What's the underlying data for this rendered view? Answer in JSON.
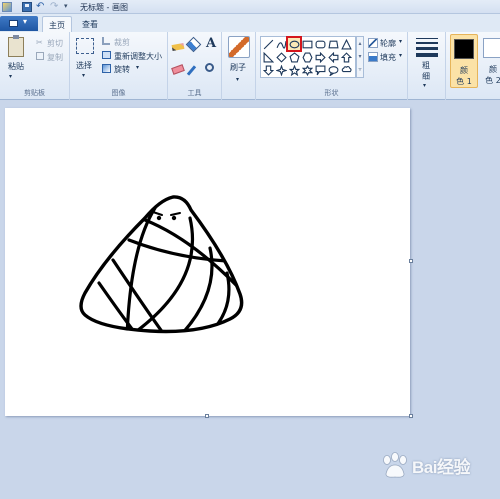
{
  "titlebar": {
    "title": "无标题 - 画图"
  },
  "tabs": {
    "home": "主页",
    "view": "查看"
  },
  "clipboard": {
    "paste": "粘贴",
    "cut": "剪切",
    "copy": "复制",
    "group": "剪贴板"
  },
  "image": {
    "select": "选择",
    "crop": "裁剪",
    "resize": "重新调整大小",
    "rotate": "旋转",
    "group": "图像"
  },
  "tools": {
    "group": "工具",
    "text_glyph": "A"
  },
  "brushes": {
    "label": "刷子"
  },
  "shapes": {
    "outline": "轮廓",
    "fill": "填充",
    "group": "形状",
    "selected": "oval"
  },
  "size": {
    "label_top": "粗",
    "label_bottom": "细"
  },
  "colors": {
    "color1_top": "颜",
    "color1_bottom": "色 1",
    "color2_top": "颜",
    "color2_bottom": "色 2",
    "color1_value": "#000000",
    "color2_value": "#ffffff"
  },
  "watermark": {
    "text": "Bai经验"
  }
}
